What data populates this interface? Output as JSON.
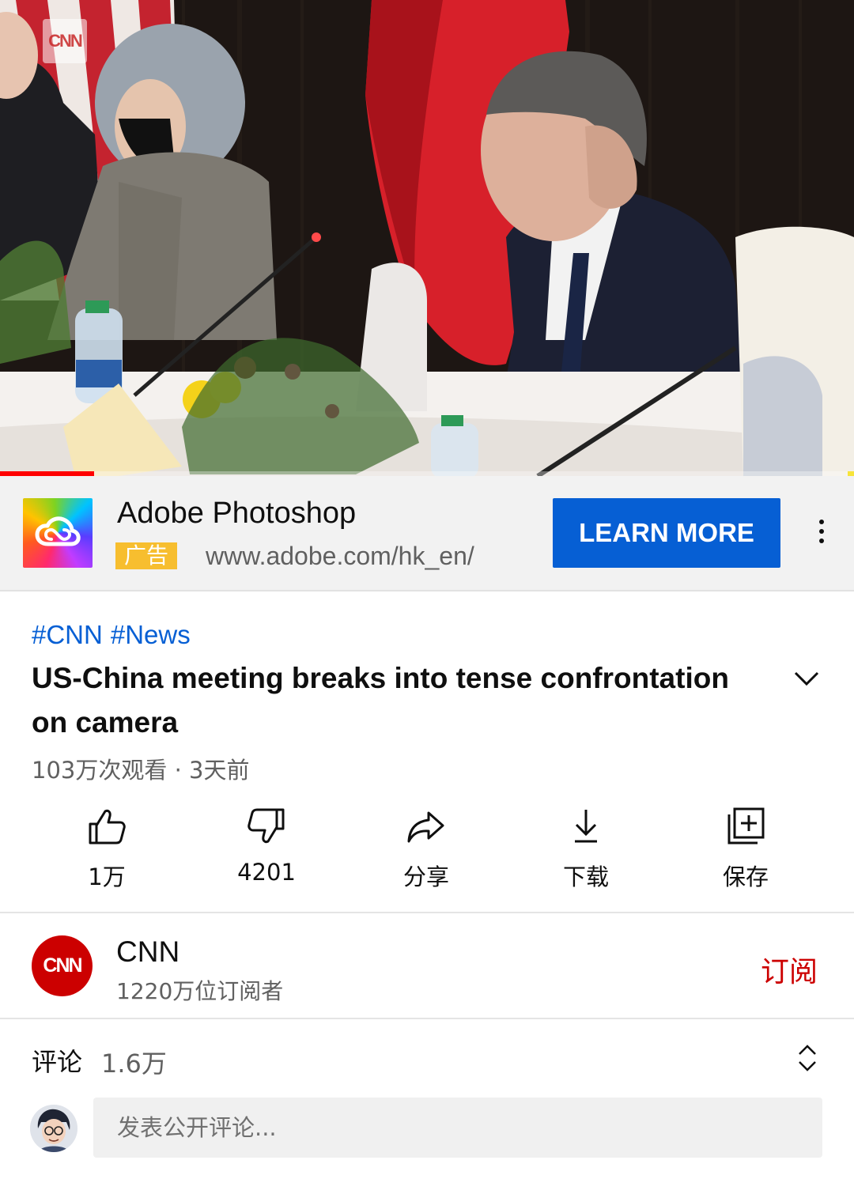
{
  "video": {
    "watermark": "CNN",
    "progress_fraction": 0.11
  },
  "ad": {
    "title": "Adobe Photoshop",
    "badge": "广告",
    "url": "www.adobe.com/hk_en/",
    "cta": "LEARN MORE",
    "logo_icon": "adobe-creative-cloud-icon",
    "menu_icon": "more-vert-icon"
  },
  "video_info": {
    "hashtags": [
      "#CNN",
      "#News"
    ],
    "title": "US-China meeting breaks into tense confrontation on camera",
    "meta": "103万次观看 · 3天前",
    "expand_icon": "chevron-down-icon"
  },
  "actions": [
    {
      "icon": "thumbs-up-icon",
      "label": "1万"
    },
    {
      "icon": "thumbs-down-icon",
      "label": "4201"
    },
    {
      "icon": "share-icon",
      "label": "分享"
    },
    {
      "icon": "download-icon",
      "label": "下载"
    },
    {
      "icon": "save-playlist-icon",
      "label": "保存"
    }
  ],
  "channel": {
    "avatar_text": "CNN",
    "name": "CNN",
    "subscribers": "1220万位订阅者",
    "subscribe_label": "订阅"
  },
  "comments": {
    "title": "评论",
    "count": "1.6万",
    "sort_icon": "unfold-icon",
    "placeholder": "发表公开评论..."
  },
  "colors": {
    "link_blue": "#065fd4",
    "cta_blue": "#065fd4",
    "subscribe_red": "#cc0000",
    "badge_yellow": "#f7be2f",
    "progress_red": "#ff0000"
  }
}
